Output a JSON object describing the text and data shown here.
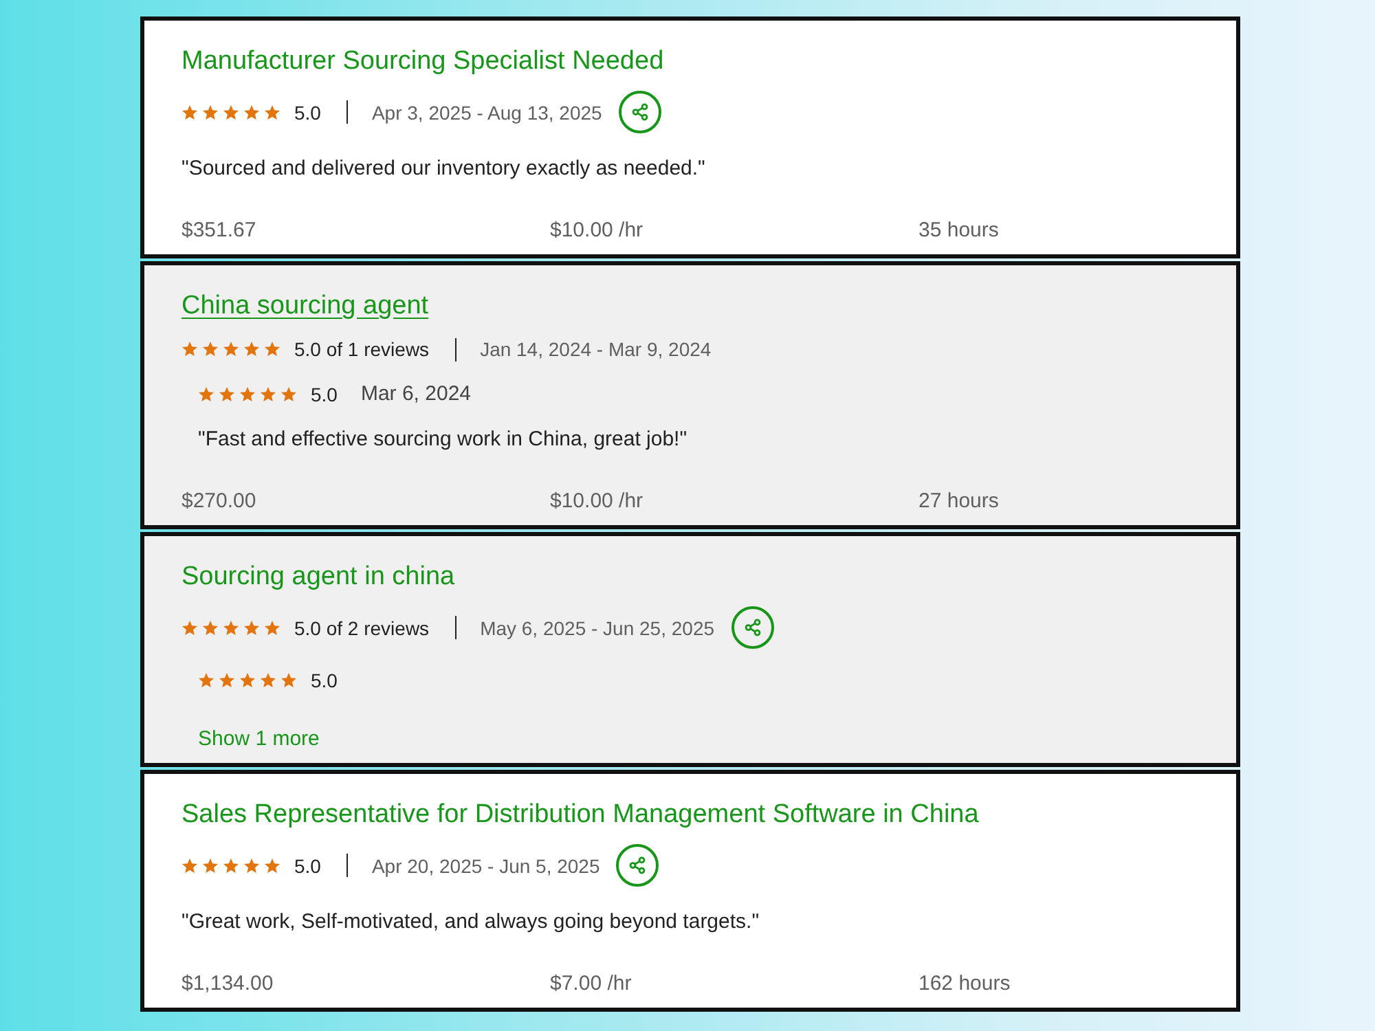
{
  "cards": [
    {
      "title": "Manufacturer Sourcing Specialist Needed",
      "shaded": false,
      "title_underlined": false,
      "stars": 5,
      "rating": "5.0",
      "date_range": "Apr 3, 2025 - Aug 13, 2025",
      "share_button": true,
      "quote": "\"Sourced and delivered our inventory exactly as needed.\"",
      "stats": [
        "$351.67",
        "$10.00 /hr",
        "35 hours"
      ]
    },
    {
      "title": "China sourcing agent",
      "shaded": true,
      "title_underlined": true,
      "stars": 5,
      "rating": "5.0 of 1 reviews",
      "date_range": "Jan 14, 2024 - Mar 9, 2024",
      "share_button": false,
      "reviews": [
        {
          "stars": 5,
          "rating": "5.0",
          "date": "Mar 6, 2024",
          "quote": "\"Fast and effective sourcing work in China, great job!\""
        }
      ],
      "stats": [
        "$270.00",
        "$10.00 /hr",
        "27 hours"
      ]
    },
    {
      "title": "Sourcing agent in china",
      "shaded": true,
      "title_underlined": false,
      "stars": 5,
      "rating": "5.0 of 2 reviews",
      "date_range": "May 6, 2025 - Jun 25, 2025",
      "share_button": true,
      "reviews": [
        {
          "stars": 5,
          "rating": "5.0"
        }
      ],
      "show_more": "Show 1 more"
    },
    {
      "title": "Sales Representative for Distribution Management Software in China",
      "shaded": false,
      "title_underlined": false,
      "stars": 5,
      "rating": "5.0",
      "date_range": "Apr 20, 2025 - Jun 5, 2025",
      "share_button": true,
      "quote": "\"Great work, Self-motivated, and always going beyond targets.\"",
      "stats": [
        "$1,134.00",
        "$7.00 /hr",
        "162 hours"
      ]
    }
  ]
}
